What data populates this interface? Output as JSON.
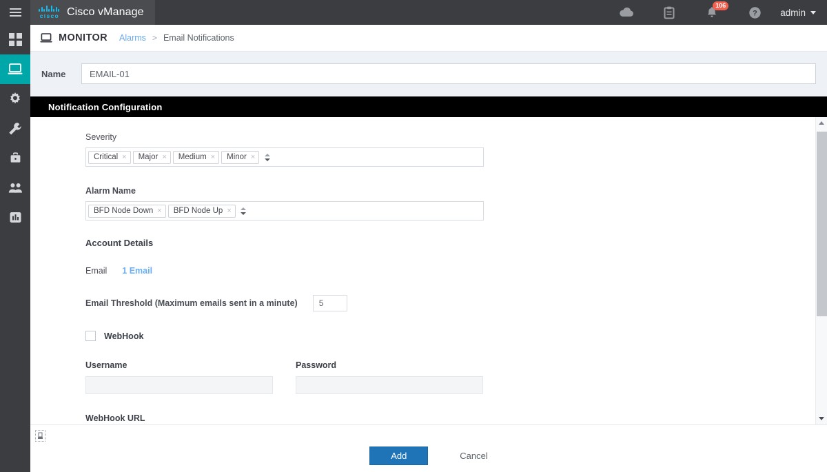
{
  "app": {
    "brand_name": "Cisco vManage",
    "cisco_wordmark": "cisco",
    "user": "admin"
  },
  "topbar": {
    "icons": [
      {
        "name": "cloud-icon",
        "glyph": "cloud"
      },
      {
        "name": "clipboard-icon",
        "glyph": "clipboard"
      },
      {
        "name": "bell-icon",
        "glyph": "bell",
        "badge": "106"
      },
      {
        "name": "help-icon",
        "glyph": "question"
      }
    ]
  },
  "sidebar": {
    "items": [
      {
        "name": "sidebar-item-dashboard",
        "icon": "dashboard-grid-icon",
        "active": false
      },
      {
        "name": "sidebar-item-monitor",
        "icon": "monitor-icon",
        "active": true
      },
      {
        "name": "sidebar-item-configuration",
        "icon": "gear-icon",
        "active": false
      },
      {
        "name": "sidebar-item-tools",
        "icon": "wrench-icon",
        "active": false
      },
      {
        "name": "sidebar-item-maintenance",
        "icon": "briefcase-icon",
        "active": false
      },
      {
        "name": "sidebar-item-administration",
        "icon": "people-icon",
        "active": false
      },
      {
        "name": "sidebar-item-workflows",
        "icon": "bar-chart-icon",
        "active": false
      }
    ]
  },
  "breadcrumb": {
    "section": "MONITOR",
    "link": "Alarms",
    "separator": ">",
    "current": "Email Notifications"
  },
  "name_row": {
    "label": "Name",
    "value": "EMAIL-01",
    "placeholder": ""
  },
  "panel": {
    "title": "Notification Configuration"
  },
  "form": {
    "severity": {
      "label": "Severity",
      "tags": [
        "Critical",
        "Major",
        "Medium",
        "Minor"
      ],
      "remove_glyph": "×"
    },
    "alarm_name": {
      "label": "Alarm Name",
      "tags": [
        "BFD Node Down",
        "BFD Node Up"
      ],
      "remove_glyph": "×"
    },
    "account_details": {
      "title": "Account Details",
      "email_label": "Email",
      "email_link": "1 Email",
      "threshold_label": "Email Threshold (Maximum emails sent in a minute)",
      "threshold_value": "5"
    },
    "webhook": {
      "checkbox_label": "WebHook",
      "checked": false,
      "username_label": "Username",
      "username_value": "",
      "username_placeholder": "",
      "password_label": "Password",
      "password_value": "",
      "password_placeholder": "",
      "url_label": "WebHook URL"
    }
  },
  "footer": {
    "add_label": "Add",
    "cancel_label": "Cancel"
  },
  "colors": {
    "accent_teal": "#00a7a8",
    "brand_cyan": "#15bef0",
    "primary_blue": "#1f73b7",
    "link_blue": "#6aaef5",
    "badge_red": "#f4604f",
    "topbar_dark": "#3c3d41",
    "panel_header_black": "#000000",
    "page_bg": "#eef1f6"
  }
}
